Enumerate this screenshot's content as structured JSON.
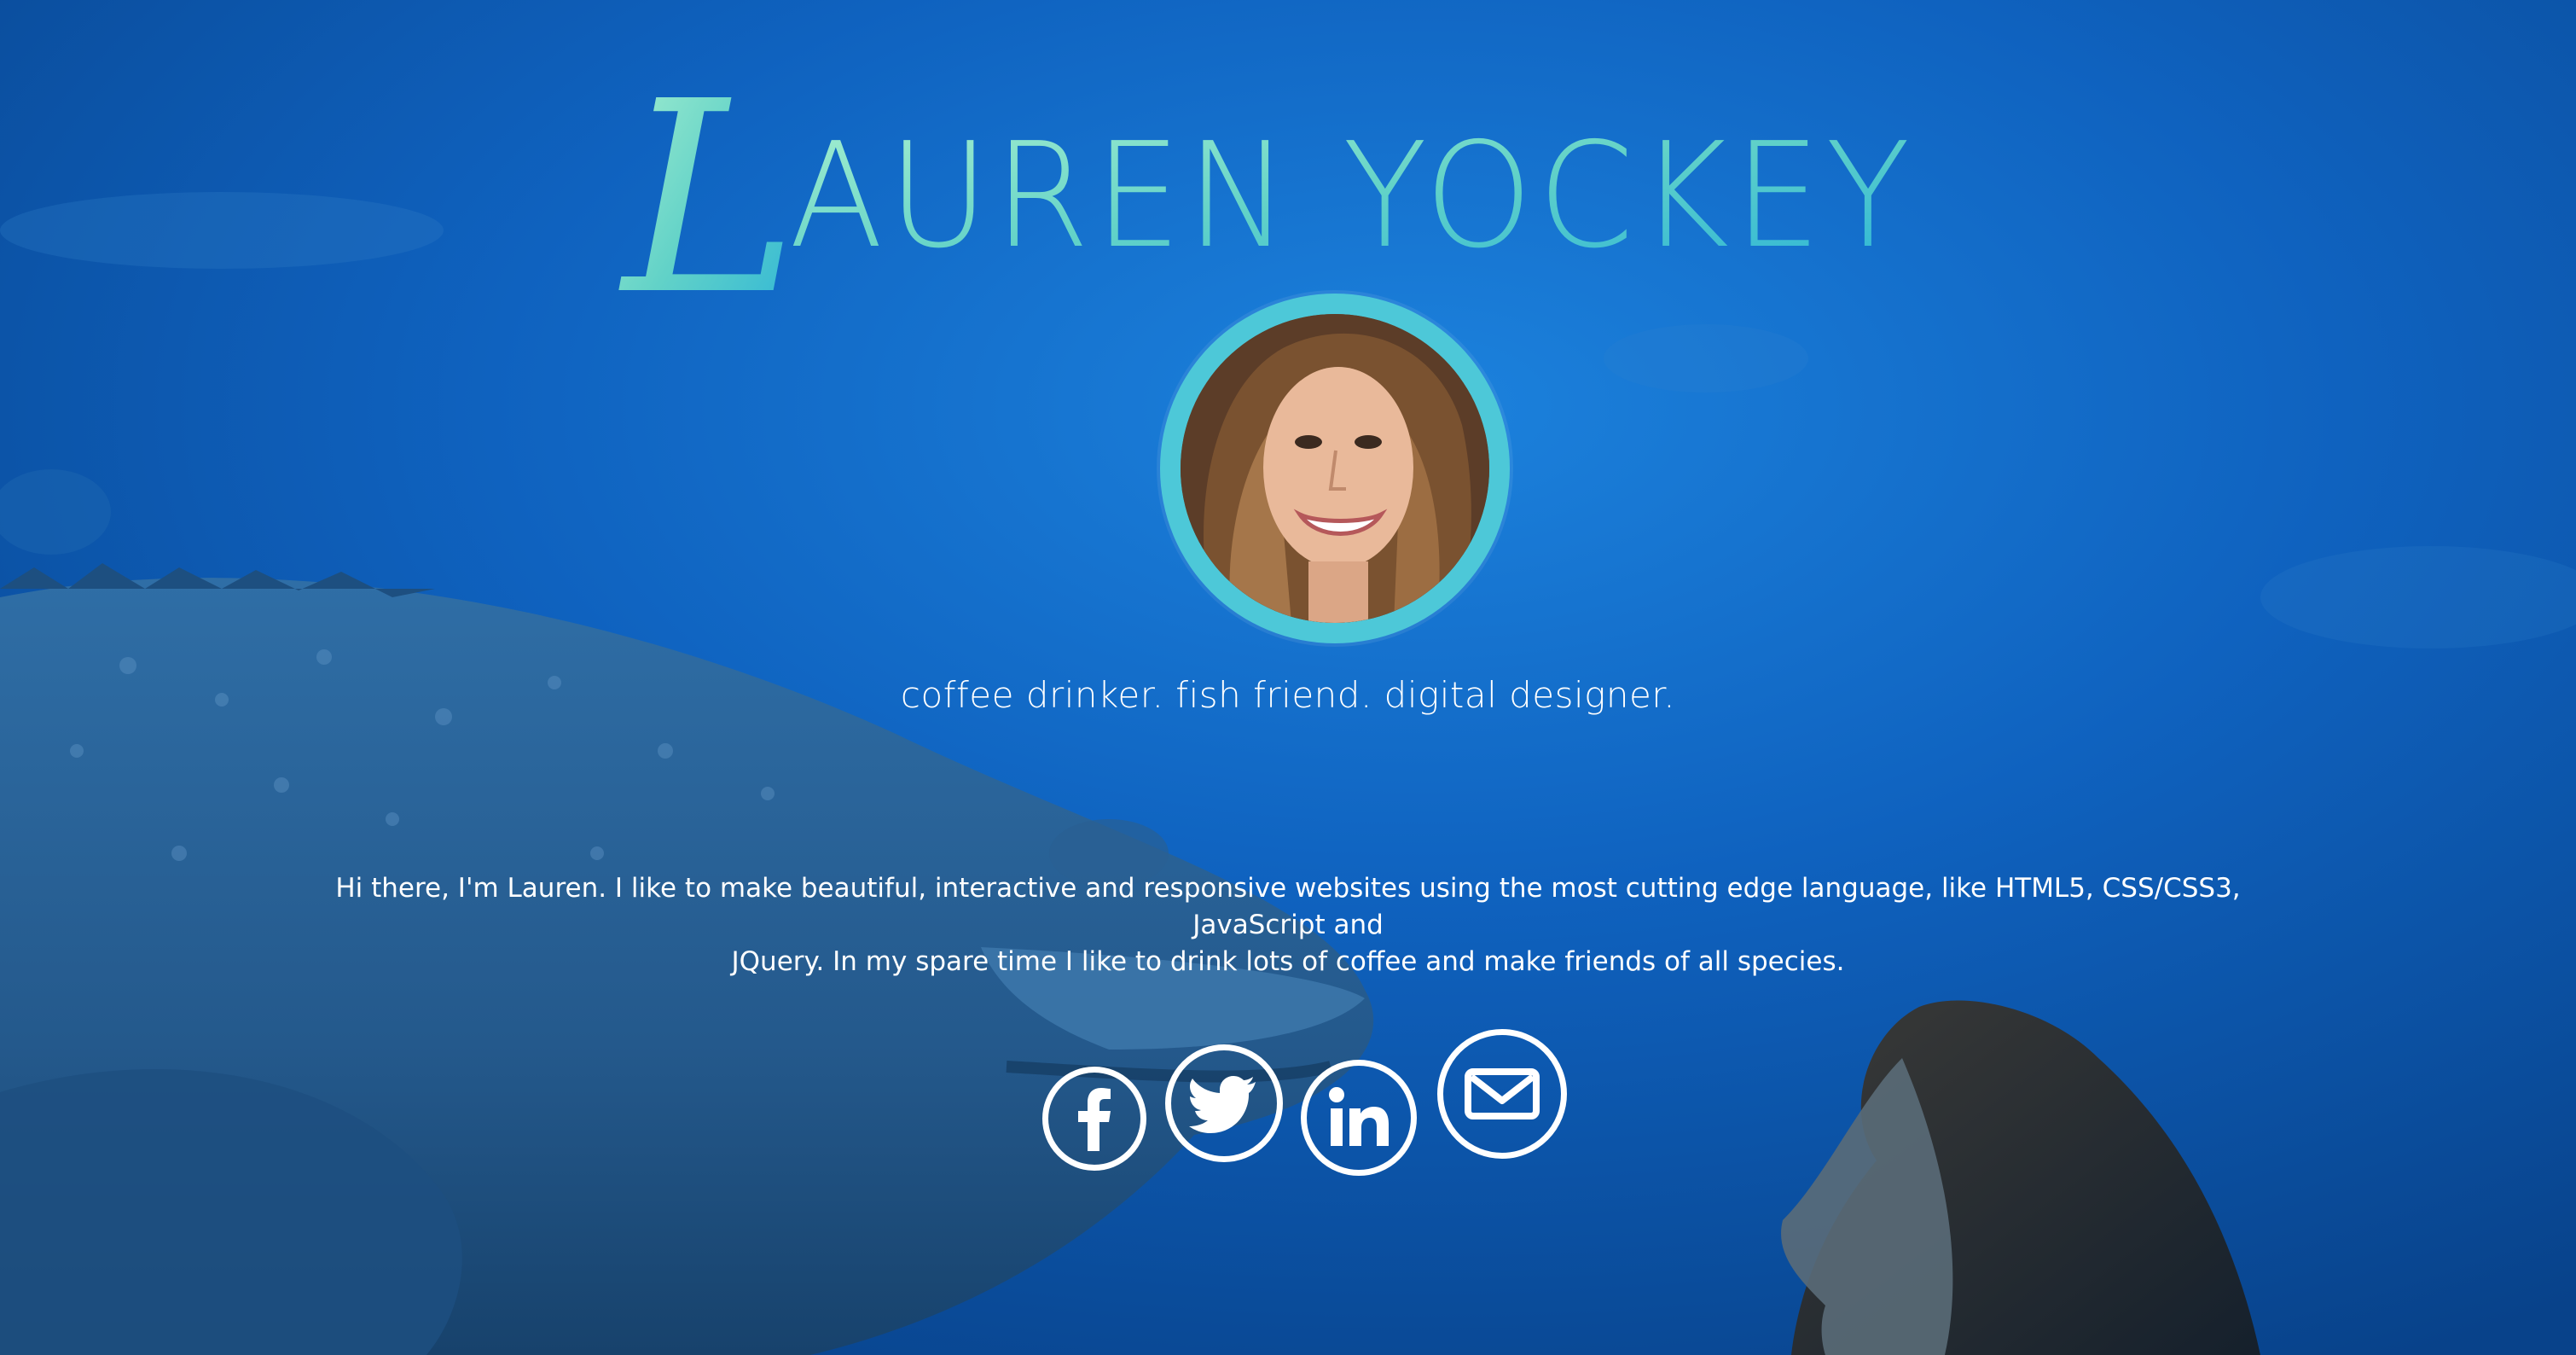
{
  "header": {
    "name": "Lauren Yockey",
    "name_initial": "L",
    "name_rest": "AUREN YOCKEY"
  },
  "profile": {
    "avatar_alt": "Lauren Yockey portrait"
  },
  "tagline": "coffee drinker. fish friend. digital designer.",
  "bio": {
    "line1": "Hi there, I'm Lauren. I like to make beautiful, interactive and responsive websites using the most cutting edge language, like HTML5, CSS/CSS3, JavaScript and",
    "line2": "JQuery. In my spare time I like to drink lots of coffee and make friends of all species."
  },
  "social": [
    {
      "network": "Facebook",
      "icon": "facebook-icon"
    },
    {
      "network": "Twitter",
      "icon": "twitter-icon"
    },
    {
      "network": "LinkedIn",
      "icon": "linkedin-icon"
    },
    {
      "network": "Email",
      "icon": "envelope-icon"
    }
  ],
  "colors": {
    "background": "#0f63c0",
    "title_gradient_start": "#8fe3d0",
    "title_gradient_end": "#2bb4d6",
    "avatar_ring": "#4dc8d8",
    "text": "#ffffff"
  }
}
